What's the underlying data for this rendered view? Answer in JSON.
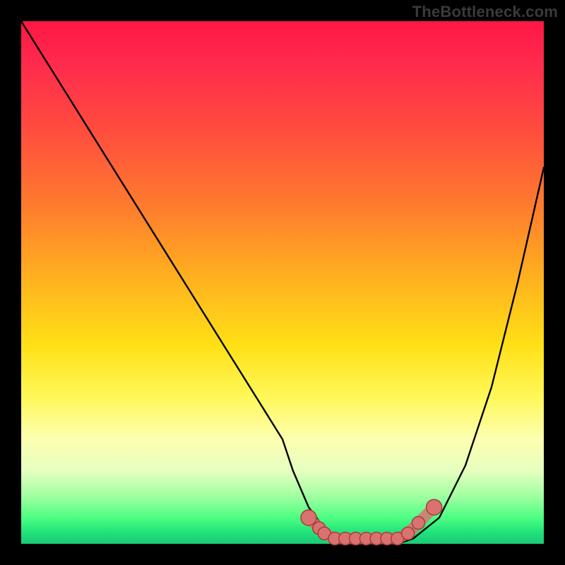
{
  "watermark": "TheBottleneck.com",
  "colors": {
    "curve_stroke": "#000000",
    "marker_stroke": "#a83b3b",
    "marker_fill": "#d9736f",
    "bottom_band": "#1cc977"
  },
  "chart_data": {
    "type": "line",
    "title": "",
    "xlabel": "",
    "ylabel": "",
    "xlim": [
      0,
      100
    ],
    "ylim": [
      0,
      100
    ],
    "x": [
      0,
      5,
      10,
      15,
      20,
      25,
      30,
      35,
      40,
      45,
      50,
      52,
      55,
      58,
      60,
      62,
      65,
      68,
      70,
      72,
      75,
      80,
      85,
      90,
      95,
      100
    ],
    "values": [
      100,
      92,
      84,
      76,
      68,
      60,
      52,
      44,
      36,
      28,
      20,
      14,
      7,
      3,
      1,
      0,
      0,
      0,
      0,
      0,
      1,
      5,
      15,
      30,
      50,
      72
    ],
    "series": [
      {
        "name": "bottleneck-curve",
        "x": [
          0,
          5,
          10,
          15,
          20,
          25,
          30,
          35,
          40,
          45,
          50,
          52,
          55,
          58,
          60,
          62,
          65,
          68,
          70,
          72,
          75,
          80,
          85,
          90,
          95,
          100
        ],
        "values": [
          100,
          92,
          84,
          76,
          68,
          60,
          52,
          44,
          36,
          28,
          20,
          14,
          7,
          3,
          1,
          0,
          0,
          0,
          0,
          0,
          1,
          5,
          15,
          30,
          50,
          72
        ]
      }
    ],
    "markers": [
      {
        "x": 55,
        "y": 5
      },
      {
        "x": 57,
        "y": 3
      },
      {
        "x": 58,
        "y": 2
      },
      {
        "x": 60,
        "y": 1
      },
      {
        "x": 62,
        "y": 1
      },
      {
        "x": 64,
        "y": 1
      },
      {
        "x": 66,
        "y": 1
      },
      {
        "x": 68,
        "y": 1
      },
      {
        "x": 70,
        "y": 1
      },
      {
        "x": 72,
        "y": 1
      },
      {
        "x": 74,
        "y": 2
      },
      {
        "x": 76,
        "y": 4
      },
      {
        "x": 79,
        "y": 7
      }
    ],
    "notes": "V-shaped bottleneck curve on rainbow heat gradient. Markers highlight the low-bottleneck sweet-spot band near the bottom."
  }
}
